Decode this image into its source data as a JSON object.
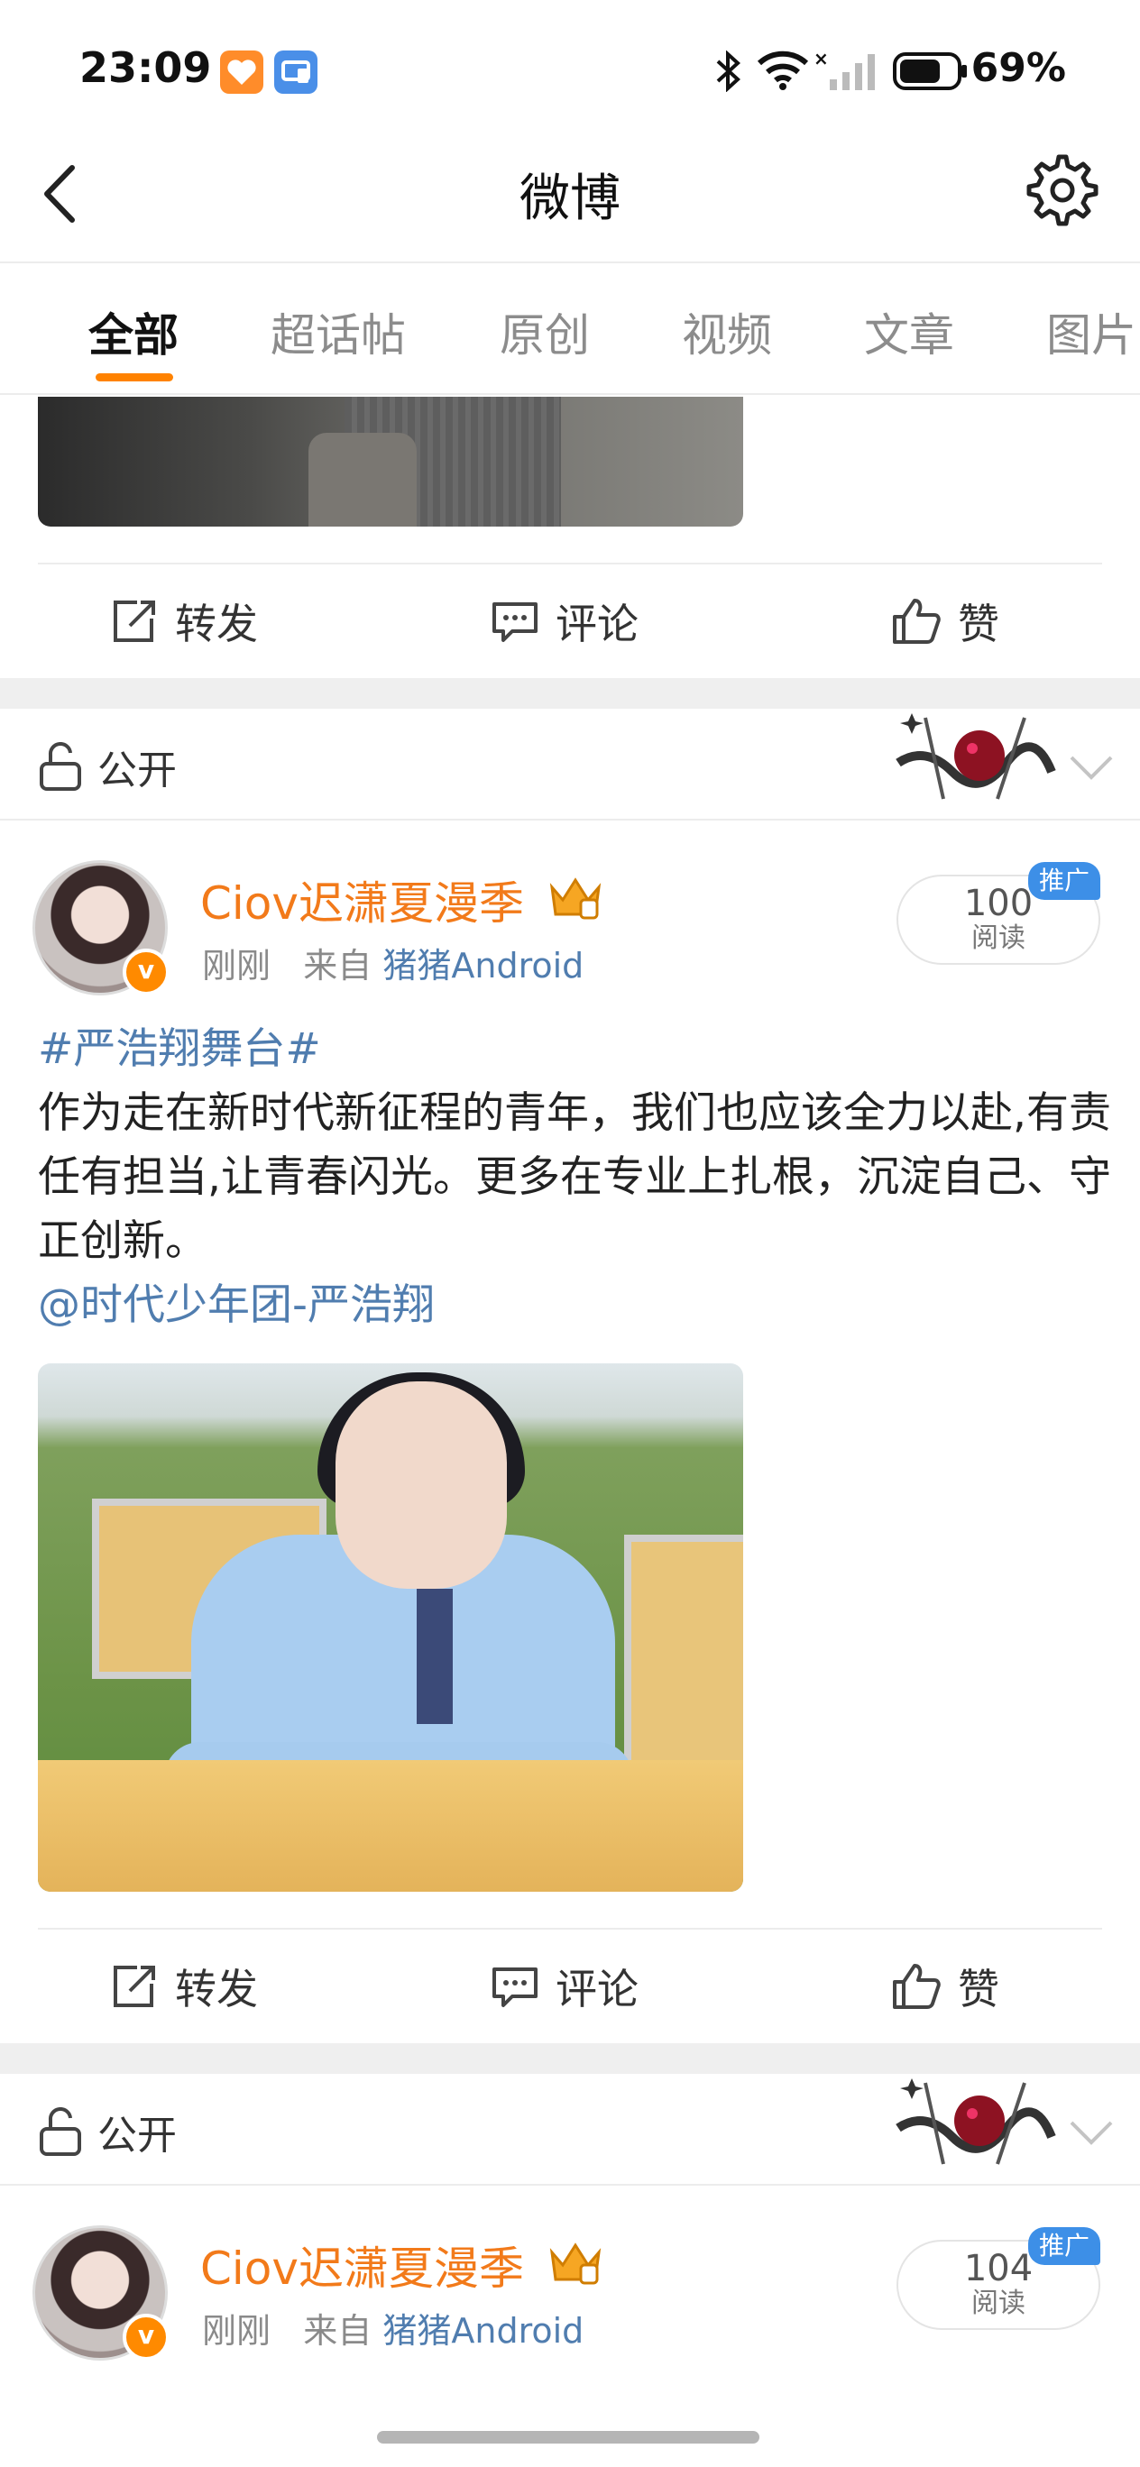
{
  "status_bar": {
    "time": "23:09",
    "battery_percent": "69%",
    "icons": [
      "heart-app-icon",
      "cast-app-icon",
      "bluetooth-icon",
      "wifi-icon",
      "signal-off-icon",
      "battery-icon"
    ],
    "colors": {
      "heart_app": "#ff8c2a",
      "cast_app": "#4a8fe8"
    }
  },
  "header": {
    "title": "微博",
    "back_icon": "chevron-left-icon",
    "settings_icon": "gear-icon"
  },
  "tabs": [
    {
      "label": "全部",
      "active": true
    },
    {
      "label": "超话帖",
      "active": false
    },
    {
      "label": "原创",
      "active": false
    },
    {
      "label": "视频",
      "active": false
    },
    {
      "label": "文章",
      "active": false
    },
    {
      "label": "图片",
      "active": false
    }
  ],
  "actions": {
    "repost": "转发",
    "comment": "评论",
    "like": "赞"
  },
  "posts": [
    {
      "visibility": "公开",
      "username": "Ciov迟潇夏漫季",
      "time": "刚刚",
      "source_prefix": "来自",
      "source": "猪猪Android",
      "reads": "100",
      "reads_label": "阅读",
      "promo_label": "推广",
      "hashtag": "#严浩翔舞台#",
      "body": "作为走在新时代新征程的青年，我们也应该全力以赴,有责任有担当,让青春闪光。更多在专业上扎根，沉淀自己、守正创新。",
      "mention": "@时代少年团-严浩翔"
    },
    {
      "visibility": "公开",
      "username": "Ciov迟潇夏漫季",
      "time": "刚刚",
      "source_prefix": "来自",
      "source": "猪猪Android",
      "reads": "104",
      "reads_label": "阅读",
      "promo_label": "推广"
    }
  ],
  "colors": {
    "accent": "#ff8200",
    "username": "#f27a1a",
    "link": "#507daf",
    "promo": "#3d8fe7"
  }
}
